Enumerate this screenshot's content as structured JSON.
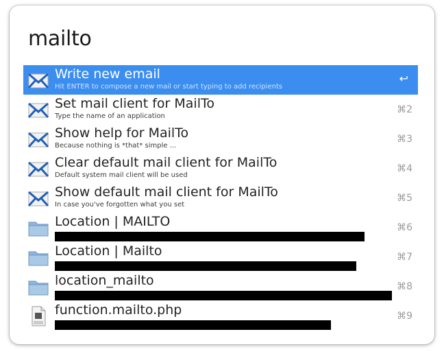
{
  "query": "mailto",
  "results": [
    {
      "title": "Write new email",
      "subtitle": "Hit ENTER to compose a new mail or start typing to add recipients",
      "shortcut": "↩",
      "icon": "mail-icon",
      "selected": true
    },
    {
      "title": "Set mail client for MailTo",
      "subtitle": "Type the name of an application",
      "shortcut": "⌘2",
      "icon": "mail-icon"
    },
    {
      "title": "Show help for MailTo",
      "subtitle": "Because nothing is *that* simple ...",
      "shortcut": "⌘3",
      "icon": "mail-icon"
    },
    {
      "title": "Clear default mail client for MailTo",
      "subtitle": "Default system mail client will be used",
      "shortcut": "⌘4",
      "icon": "mail-icon"
    },
    {
      "title": "Show default mail client for MailTo",
      "subtitle": "In case you've forgotten what you set",
      "shortcut": "⌘5",
      "icon": "mail-icon"
    },
    {
      "title": "Location | MAILTO",
      "subtitle": "",
      "shortcut": "⌘6",
      "icon": "folder-icon"
    },
    {
      "title": "Location | Mailto",
      "subtitle": "",
      "shortcut": "⌘7",
      "icon": "folder-icon"
    },
    {
      "title": "location_mailto",
      "subtitle": "",
      "shortcut": "⌘8",
      "icon": "folder-icon"
    },
    {
      "title": "function.mailto.php",
      "subtitle": "",
      "shortcut": "⌘9",
      "icon": "php-file-icon"
    }
  ],
  "colors": {
    "selection": "#3b8ef0",
    "folder": "#8eb6da",
    "mail_blue": "#1e5fb8"
  }
}
